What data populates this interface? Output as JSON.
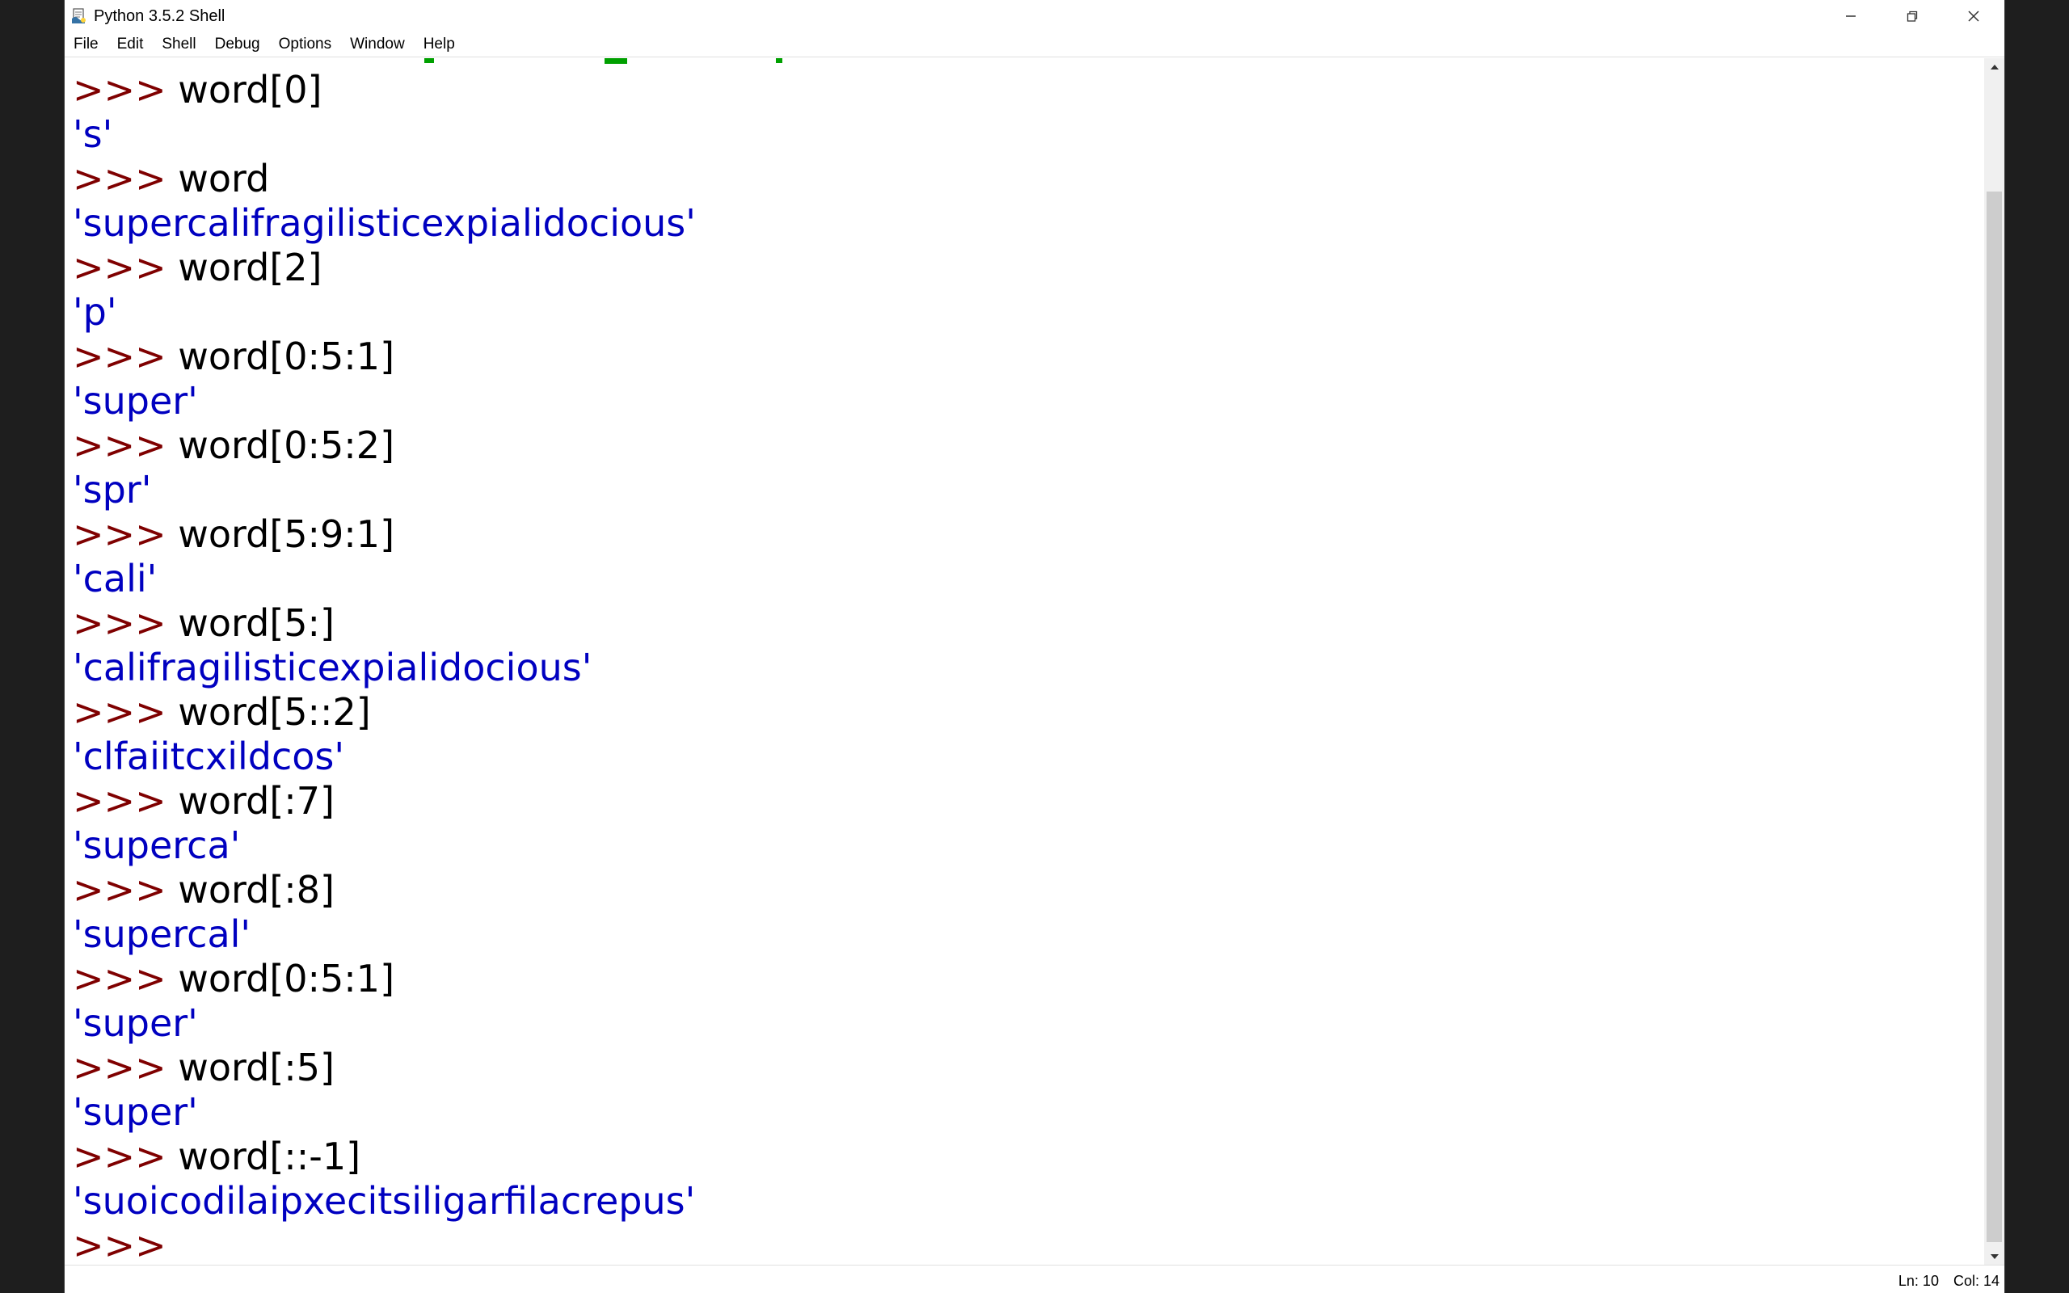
{
  "window": {
    "title": "Python 3.5.2 Shell",
    "icon": "python-idle-icon"
  },
  "menu": [
    {
      "label": "File"
    },
    {
      "label": "Edit"
    },
    {
      "label": "Shell"
    },
    {
      "label": "Debug"
    },
    {
      "label": "Options"
    },
    {
      "label": "Window"
    },
    {
      "label": "Help"
    }
  ],
  "shell": {
    "prompt": ">>> ",
    "lines": [
      {
        "kind": "input",
        "text": "word[0]"
      },
      {
        "kind": "output",
        "text": "'s'"
      },
      {
        "kind": "input",
        "text": "word"
      },
      {
        "kind": "output",
        "text": "'supercalifragilisticexpialidocious'"
      },
      {
        "kind": "input",
        "text": "word[2]"
      },
      {
        "kind": "output",
        "text": "'p'"
      },
      {
        "kind": "input",
        "text": "word[0:5:1]"
      },
      {
        "kind": "output",
        "text": "'super'"
      },
      {
        "kind": "input",
        "text": "word[0:5:2]"
      },
      {
        "kind": "output",
        "text": "'spr'"
      },
      {
        "kind": "input",
        "text": "word[5:9:1]"
      },
      {
        "kind": "output",
        "text": "'cali'"
      },
      {
        "kind": "input",
        "text": "word[5:]"
      },
      {
        "kind": "output",
        "text": "'califragilisticexpialidocious'"
      },
      {
        "kind": "input",
        "text": "word[5::2]"
      },
      {
        "kind": "output",
        "text": "'clfaiitcxildcos'"
      },
      {
        "kind": "input",
        "text": "word[:7]"
      },
      {
        "kind": "output",
        "text": "'superca'"
      },
      {
        "kind": "input",
        "text": "word[:8]"
      },
      {
        "kind": "output",
        "text": "'supercal'"
      },
      {
        "kind": "input",
        "text": "word[0:5:1]"
      },
      {
        "kind": "output",
        "text": "'super'"
      },
      {
        "kind": "input",
        "text": "word[:5]"
      },
      {
        "kind": "output",
        "text": "'super'"
      },
      {
        "kind": "input",
        "text": "word[::-1]"
      },
      {
        "kind": "output",
        "text": "'suoicodilaipxecitsiligarfilacrepus'"
      },
      {
        "kind": "input",
        "text": ""
      }
    ]
  },
  "status": {
    "line": "Ln: 10",
    "col": "Col: 14"
  },
  "colors": {
    "prompt": "#7f0000",
    "input": "#000000",
    "output": "#0000c0",
    "partial_green": "#00a000"
  }
}
